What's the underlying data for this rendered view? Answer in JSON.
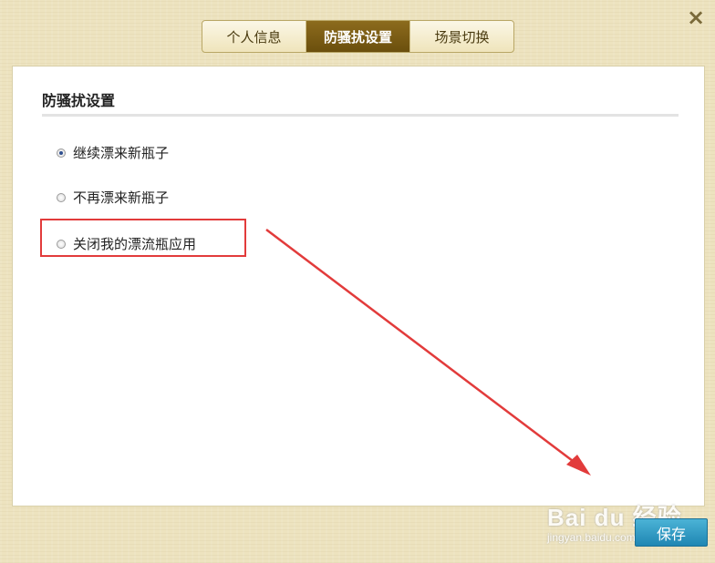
{
  "window": {
    "close_label": "×"
  },
  "tabs": [
    {
      "label": "个人信息",
      "active": false
    },
    {
      "label": "防骚扰设置",
      "active": true
    },
    {
      "label": "场景切换",
      "active": false
    }
  ],
  "panel": {
    "heading": "防骚扰设置",
    "options": [
      {
        "label": "继续漂来新瓶子",
        "checked": true
      },
      {
        "label": "不再漂来新瓶子",
        "checked": false
      },
      {
        "label": "关闭我的漂流瓶应用",
        "checked": false
      }
    ]
  },
  "footer": {
    "save_label": "保存"
  },
  "watermark": {
    "logo": "Bai du 经验",
    "url": "jingyan.baidu.com"
  },
  "annotation": {
    "highlight_color": "#e23b3b",
    "arrow_color": "#e23b3b"
  }
}
